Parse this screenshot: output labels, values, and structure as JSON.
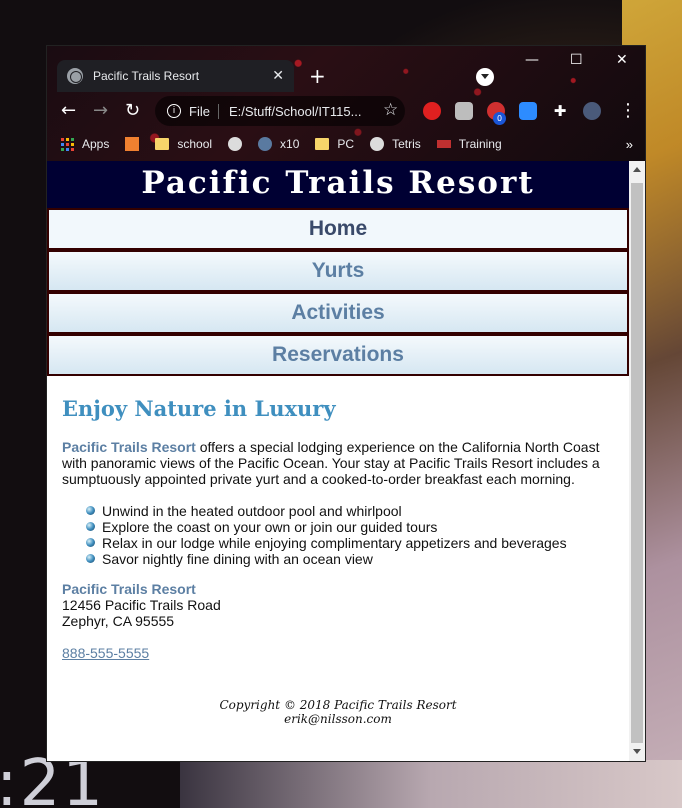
{
  "browser": {
    "tab_title": "Pacific Trails Resort",
    "address_scheme": "File",
    "address_url": "E:/Stuff/School/IT115...",
    "extension_badge": "0",
    "bookmarks": [
      "Apps",
      "school",
      "x10",
      "PC",
      "Tetris",
      "Training"
    ]
  },
  "site": {
    "header": "Pacific Trails Resort",
    "nav": [
      "Home",
      "Yurts",
      "Activities",
      "Reservations"
    ],
    "heading": "Enjoy Nature in Luxury",
    "intro_brand": "Pacific Trails Resort",
    "intro_text": " offers a special lodging experience on the California North Coast with panoramic views of the Pacific Ocean. Your stay at Pacific Trails Resort includes a sumptuously appointed private yurt and a cooked-to-order breakfast each morning.",
    "features": [
      "Unwind in the heated outdoor pool and whirlpool",
      "Explore the coast on your own or join our guided tours",
      "Relax in our lodge while enjoying complimentary appetizers and beverages",
      "Savor nightly fine dining with an ocean view"
    ],
    "address": {
      "name": "Pacific Trails Resort",
      "street": "12456 Pacific Trails Road",
      "city": "Zephyr, CA 95555"
    },
    "phone": "888-555-5555",
    "footer_copyright": "Copyright © 2018 Pacific Trails Resort",
    "footer_email": "erik@nilsson.com"
  },
  "desktop": {
    "clock_fragment": ":21"
  },
  "colors": {
    "header_bg": "#000033",
    "brand_text": "#5c7fa3",
    "heading": "#3f8fbf",
    "nav_border": "#330000"
  }
}
